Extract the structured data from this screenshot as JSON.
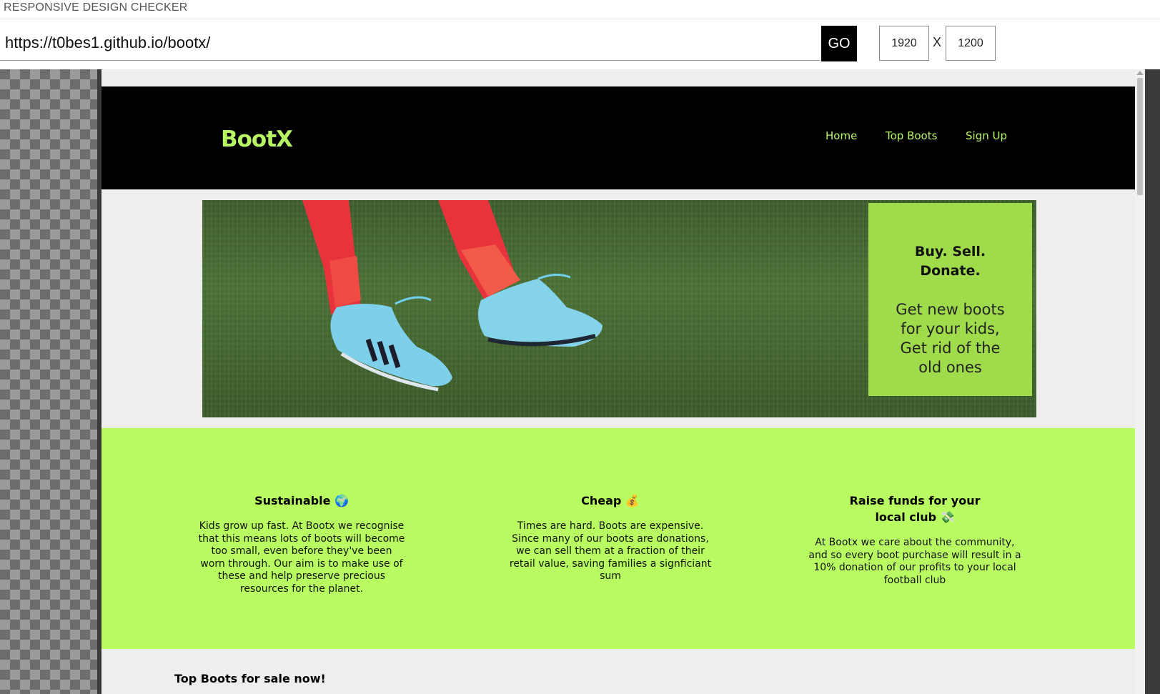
{
  "checker": {
    "title": "RESPONSIVE DESIGN CHECKER",
    "url": "https://t0bes1.github.io/bootx/",
    "go_label": "GO",
    "width": "1920",
    "height": "1200",
    "separator": "X"
  },
  "site": {
    "logo": "BootX",
    "nav": [
      "Home",
      "Top Boots",
      "Sign Up"
    ],
    "hero": {
      "title_line1": "Buy. Sell.",
      "title_line2": "Donate.",
      "text_line1": "Get new boots",
      "text_line2": "for your kids,",
      "text_line3": "Get rid of the",
      "text_line4": "old ones"
    },
    "features": [
      {
        "title": "Sustainable 🌍",
        "text": "Kids grow up fast. At Bootx we recognise that this means lots of boots will become too small, even before they've been worn through. Our aim is to make use of these and help preserve precious resources for the planet."
      },
      {
        "title": "Cheap 💰",
        "text": "Times are hard. Boots are expensive. Since many of our boots are donations, we can sell them at a fraction of their retail value, saving families a signficiant sum"
      },
      {
        "title": "Raise funds for your local club 💸",
        "text": "At Bootx we care about the community, and so every boot purchase will result in a 10% donation of our profits to your local football club"
      }
    ],
    "section_heading": "Top Boots for sale now!"
  },
  "colors": {
    "accent": "#b8fc62",
    "nav_bg": "#000000",
    "callout_bg": "#9fdb4a"
  }
}
